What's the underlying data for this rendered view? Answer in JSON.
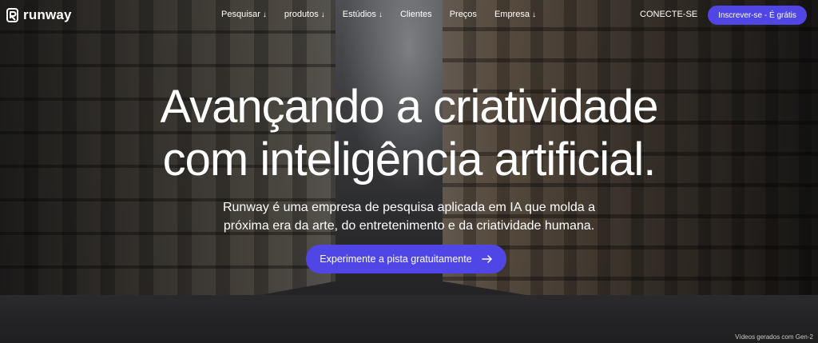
{
  "brand": {
    "name": "runway"
  },
  "nav": {
    "items": [
      {
        "label": "Pesquisar",
        "arrow": "↓"
      },
      {
        "label": "produtos",
        "arrow": "↓"
      },
      {
        "label": "Estúdios",
        "arrow": "↓"
      },
      {
        "label": "Clientes",
        "arrow": ""
      },
      {
        "label": "Preços",
        "arrow": ""
      },
      {
        "label": "Empresa",
        "arrow": "↓"
      }
    ],
    "signin_label": "CONECTE-SE",
    "signup_label": "Inscrever-se - É grátis"
  },
  "hero": {
    "headline_line1": "Avançando a criatividade",
    "headline_line2": "com inteligência artificial.",
    "subtitle_line1": "Runway é uma empresa de pesquisa aplicada em IA que molda a",
    "subtitle_line2": "próxima era da arte, do entretenimento e da criatividade humana.",
    "cta_label": "Experimente a pista gratuitamente"
  },
  "footer_note": "Vídeos gerados com Gen-2",
  "colors": {
    "accent": "#4f46e5",
    "text": "#ffffff"
  }
}
